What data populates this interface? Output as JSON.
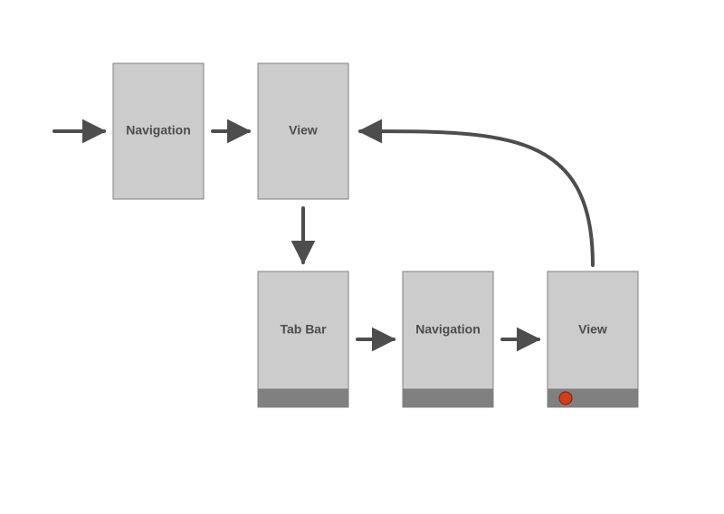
{
  "nodes": {
    "nav_top": {
      "label": "Navigation"
    },
    "view_top": {
      "label": "View"
    },
    "tabbar": {
      "label": "Tab Bar"
    },
    "nav_bot": {
      "label": "Navigation"
    },
    "view_bot": {
      "label": "View"
    }
  },
  "edges": [
    {
      "from": "start",
      "to": "nav_top"
    },
    {
      "from": "nav_top",
      "to": "view_top"
    },
    {
      "from": "view_top",
      "to": "tabbar"
    },
    {
      "from": "tabbar",
      "to": "nav_bot"
    },
    {
      "from": "nav_bot",
      "to": "view_bot"
    },
    {
      "from": "view_bot",
      "to": "view_top"
    }
  ]
}
